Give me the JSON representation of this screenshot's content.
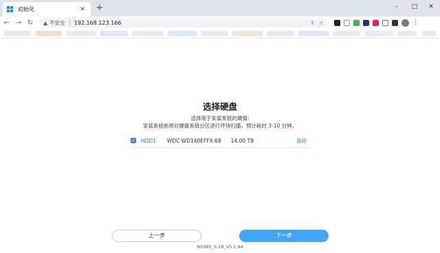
{
  "browser": {
    "tab_title": "初始化",
    "tab_close": "✕",
    "new_tab": "+",
    "win_minimize": "–",
    "win_maximize": "□",
    "win_close": "✕",
    "nav_back": "←",
    "nav_forward": "→",
    "nav_reload": "↻",
    "security_label": "不安全",
    "url": "192.168.123.166",
    "menu": "⋮",
    "icons": [
      "windows-logo-icon",
      "warning-icon",
      "share-icon",
      "star-icon",
      "extension-icon",
      "avatar-icon"
    ]
  },
  "main": {
    "title": "选择硬盘",
    "subtitle_1": "选择用于安装系统的硬盘:",
    "subtitle_2": "安装系统前将对硬盘系统分区进行坏块扫描，预计耗时 3-10 分钟。",
    "disks": [
      {
        "checked": true,
        "id": "HDD1",
        "model": "WDC WD140EFFX-68",
        "size": "14.00 TB",
        "status": "良好"
      }
    ]
  },
  "footer": {
    "prev_label": "上一步",
    "next_label": "下一步",
    "version": "N5095_5.19_V5.1.44"
  },
  "colors": {
    "accent": "#42a5f5",
    "link": "#2f6fde",
    "good": "#22a32f",
    "chrome": "#dfe3ea"
  }
}
